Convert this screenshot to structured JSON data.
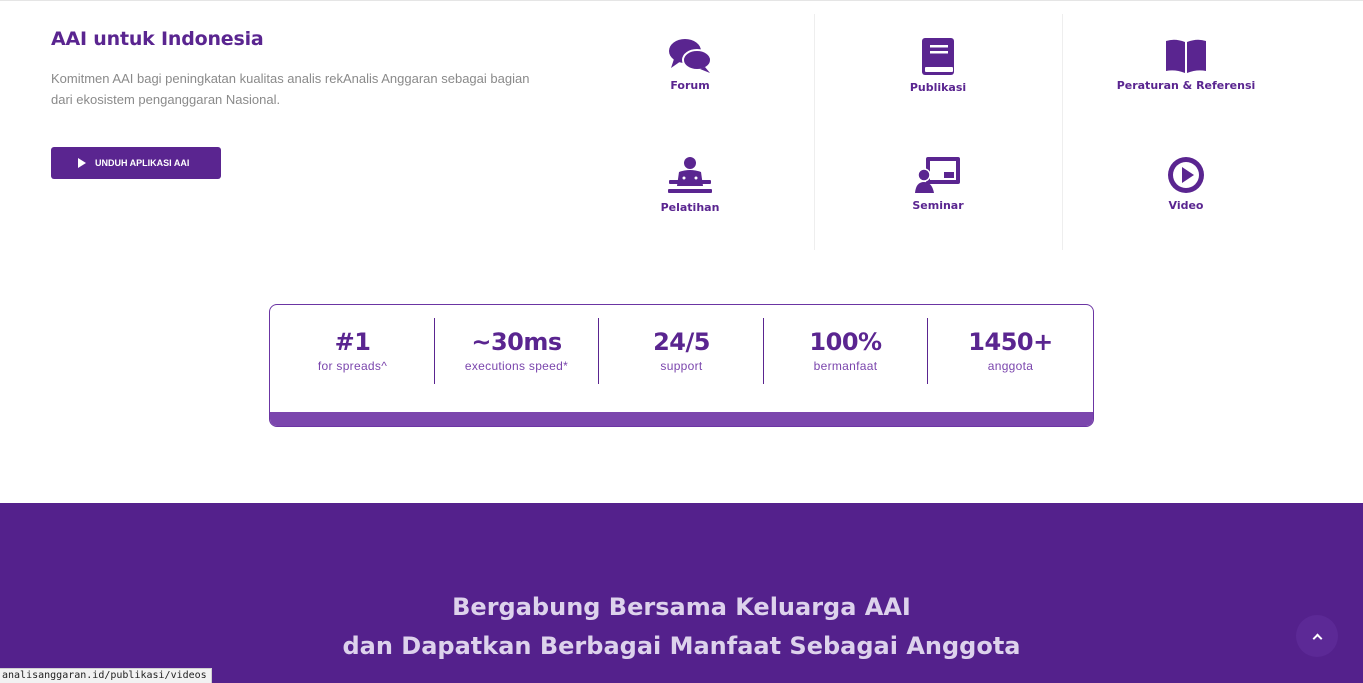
{
  "intro": {
    "title": "AAI untuk Indonesia",
    "description": "Komitmen AAI bagi peningkatan kualitas analis rekAnalis Anggaran sebagai bagian dari ekosistem penganggaran Nasional.",
    "download_button": "UNDUH APLIKASI AAI",
    "download_icon": "play-icon"
  },
  "features": [
    {
      "label": "Forum",
      "icon": "comments-icon"
    },
    {
      "label": "Publikasi",
      "icon": "book-icon"
    },
    {
      "label": "Peraturan & Referensi",
      "icon": "open-book-icon"
    },
    {
      "label": "Pelatihan",
      "icon": "trainer-icon"
    },
    {
      "label": "Seminar",
      "icon": "presentation-icon"
    },
    {
      "label": "Video",
      "icon": "play-circle-icon"
    }
  ],
  "stats": [
    {
      "value": "#1",
      "label": "for spreads^"
    },
    {
      "value": "~30ms",
      "label": "executions speed*"
    },
    {
      "value": "24/5",
      "label": "support"
    },
    {
      "value": "100%",
      "label": "bermanfaat"
    },
    {
      "value": "1450+",
      "label": "anggota"
    }
  ],
  "join": {
    "line1": "Bergabung Bersama Keluarga AAI",
    "line2": "dan Dapatkan Berbagai Manfaat Sebagai Anggota"
  },
  "scroll_top_icon": "chevron-up-icon",
  "status_bar_url": "analisanggaran.id/publikasi/videos",
  "colors": {
    "brand_purple": "#5a2590",
    "section_purple": "#54218c",
    "stat_bar": "#7b46ad"
  }
}
